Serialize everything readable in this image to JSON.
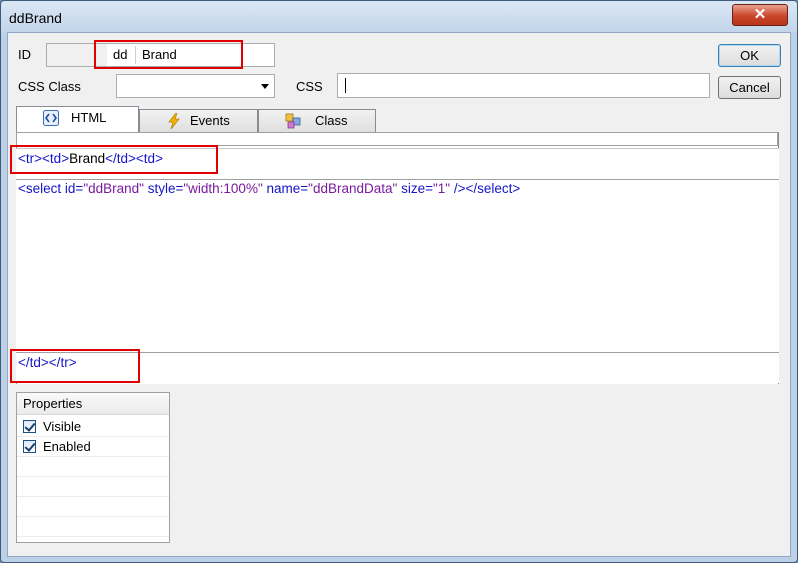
{
  "window": {
    "title": "ddBrand",
    "close_label": "✕"
  },
  "form": {
    "id_label": "ID",
    "id_prefix": "dd",
    "id_value": "Brand",
    "css_class_label": "CSS Class",
    "css_class_value": "",
    "css_label": "CSS",
    "css_value": ""
  },
  "buttons": {
    "ok": "OK",
    "cancel": "Cancel"
  },
  "tabs": [
    {
      "label": "HTML",
      "icon": "html-tag-icon",
      "active": true
    },
    {
      "label": "Events",
      "icon": "lightning-icon",
      "active": false
    },
    {
      "label": "Class",
      "icon": "class-puzzle-icon",
      "active": false
    }
  ],
  "code": {
    "before": {
      "p1": "<",
      "t1": "tr",
      "p2": "><",
      "t2": "td",
      "p3": ">",
      "text": "Brand",
      "p4": "</",
      "t3": "td",
      "p5": "><",
      "t4": "td",
      "p6": ">"
    },
    "main": {
      "p1": "<",
      "tag": "select",
      "a1": " id=",
      "v1": "\"ddBrand\"",
      "a2": " style=",
      "v2": "\"width:100%\"",
      "a3": " name=",
      "v3": "\"ddBrandData\"",
      "a4": " size=",
      "v4": "\"1\"",
      "p2": " /><",
      "tag2": "/select",
      "p3": ">"
    },
    "after": {
      "p1": "</",
      "t1": "td",
      "p2": "></",
      "t2": "tr",
      "p3": ">"
    }
  },
  "properties": {
    "header": "Properties",
    "items": [
      {
        "label": "Visible",
        "checked": true
      },
      {
        "label": "Enabled",
        "checked": true
      }
    ]
  }
}
